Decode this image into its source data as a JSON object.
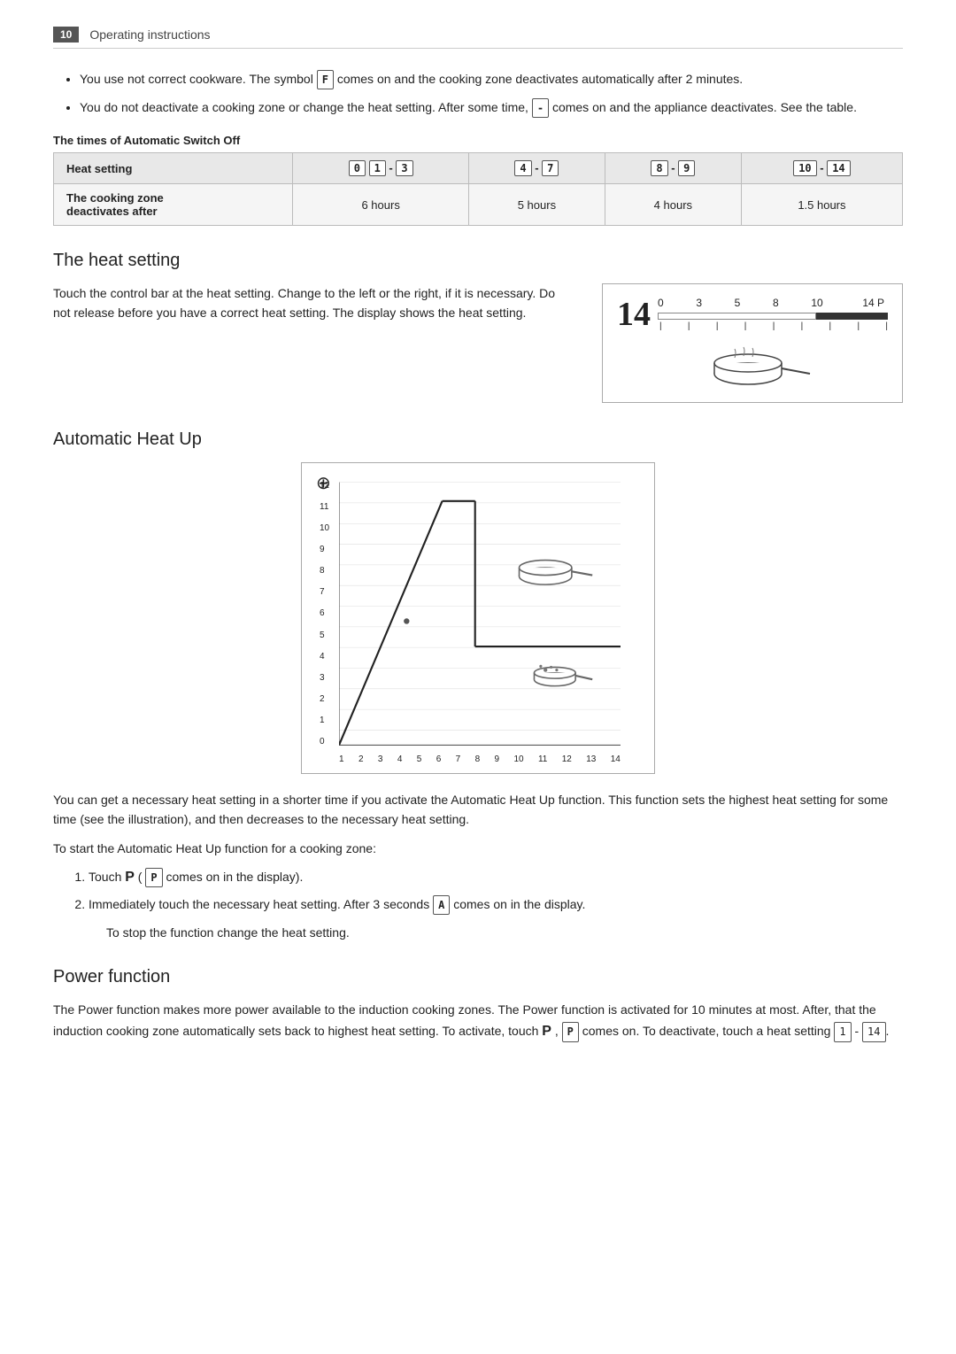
{
  "header": {
    "page_number": "10",
    "title": "Operating instructions"
  },
  "bullet_items": [
    "You use not correct cookware. The symbol comes on and the cooking zone deactivates automatically after 2 minutes.",
    "You do not deactivate a cooking zone or change the heat setting. After some time, comes on and the appliance deactivates. See the table."
  ],
  "table": {
    "title": "The times of Automatic Switch Off",
    "headers": [
      "Heat setting",
      "0 1 - 3",
      "4 - 7",
      "8 - 9",
      "10 - 14"
    ],
    "row_label": "The cooking zone deactivates after",
    "row_values": [
      "6 hours",
      "5 hours",
      "4 hours",
      "1.5 hours"
    ]
  },
  "heat_setting": {
    "heading": "The heat setting",
    "text": "Touch the control bar at the heat setting. Change to the left or the right, if it is necessary. Do not release before you have a correct heat setting. The display shows the heat setting.",
    "diagram_labels": [
      "0",
      "3",
      "5",
      "8",
      "10",
      "14",
      "P"
    ],
    "diagram_display": "14"
  },
  "auto_heat": {
    "heading": "Automatic Heat Up",
    "text1": "You can get a necessary heat setting in a shorter time if you activate the Automatic Heat Up function. This function sets the highest heat setting for some time (see the illustration), and then decreases to the necessary heat setting.",
    "text2": "To start the Automatic Heat Up function for a cooking zone:",
    "steps": [
      "Touch P ( comes on in the display).",
      "Immediately touch the necessary heat setting. After 3 seconds comes on in the display."
    ],
    "stop_text": "To stop the function change the heat setting.",
    "chart": {
      "y_labels": [
        "0",
        "1",
        "2",
        "3",
        "4",
        "5",
        "6",
        "7",
        "8",
        "9",
        "10",
        "11",
        "12"
      ],
      "x_labels": [
        "1",
        "2",
        "3",
        "4",
        "5",
        "6",
        "7",
        "8",
        "9",
        "10",
        "11",
        "12",
        "13",
        "14"
      ]
    }
  },
  "power_function": {
    "heading": "Power function",
    "text": "The Power function makes more power available to the induction cooking zones. The Power function is activated for 10 minutes at most. After, that the induction cooking zone automatically sets back to highest heat setting. To activate, touch P , comes on. To deactivate, touch a heat setting 1 - 14."
  }
}
